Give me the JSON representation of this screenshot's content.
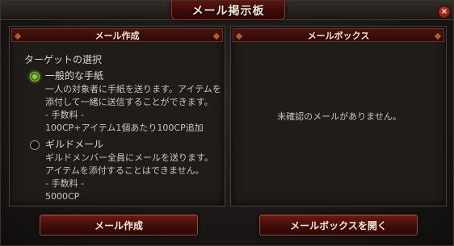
{
  "window": {
    "title": "メール掲示板",
    "close_label": "×"
  },
  "compose": {
    "header": "メール作成",
    "section_label": "ターゲットの選択",
    "options": [
      {
        "label": "一般的な手紙",
        "checked": true,
        "desc": [
          "一人の対象者に手紙を送ります。アイテムを",
          "添付して一緒に送信することができます。"
        ],
        "fee_label": "- 手数料 -",
        "fee": "100CP+アイテム1個あたり100CP追加"
      },
      {
        "label": "ギルドメール",
        "checked": false,
        "desc": [
          "ギルドメンバー全員にメールを送ります。",
          "アイテムを添付することはできません。"
        ],
        "fee_label": "- 手数料 -",
        "fee": "5000CP"
      }
    ]
  },
  "mailbox": {
    "header": "メールボックス",
    "empty_message": "未確認のメールがありません。"
  },
  "buttons": {
    "compose": "メール作成",
    "open_mailbox": "メールボックスを開く"
  },
  "colors": {
    "accent": "#5e1410",
    "radio_checked": "#9ad03a"
  }
}
